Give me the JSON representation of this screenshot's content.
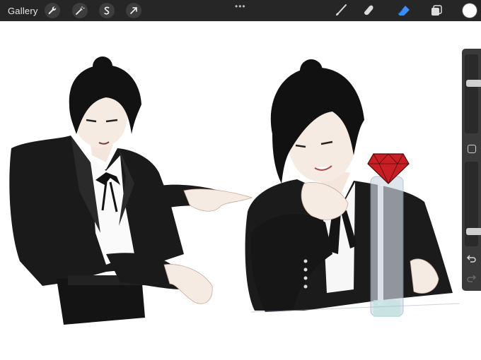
{
  "topbar": {
    "gallery_label": "Gallery",
    "actions": [
      {
        "name": "actions",
        "icon": "wrench-icon"
      },
      {
        "name": "adjustments",
        "icon": "magic-wand-icon"
      },
      {
        "name": "selection",
        "icon": "selection-s-icon"
      },
      {
        "name": "transform",
        "icon": "arrow-cursor-icon"
      }
    ],
    "more_label": "•••",
    "tools": [
      {
        "name": "brush",
        "icon": "brush-icon"
      },
      {
        "name": "smudge",
        "icon": "smudge-finger-icon"
      },
      {
        "name": "eraser",
        "icon": "eraser-icon",
        "active": true
      },
      {
        "name": "layers",
        "icon": "layers-icon"
      }
    ],
    "current_color": "#ffffff",
    "active_tool_color": "#3b8cff"
  },
  "sidebar": {
    "brush_size_level": 0.65,
    "opacity_level": 0.15,
    "buttons": [
      {
        "name": "modifier",
        "icon": "square-icon"
      },
      {
        "name": "undo",
        "icon": "undo-arrow-icon"
      },
      {
        "name": "redo",
        "icon": "redo-arrow-icon"
      }
    ]
  },
  "canvas": {
    "artwork": "two-character-sketch",
    "background": "#ffffff"
  }
}
